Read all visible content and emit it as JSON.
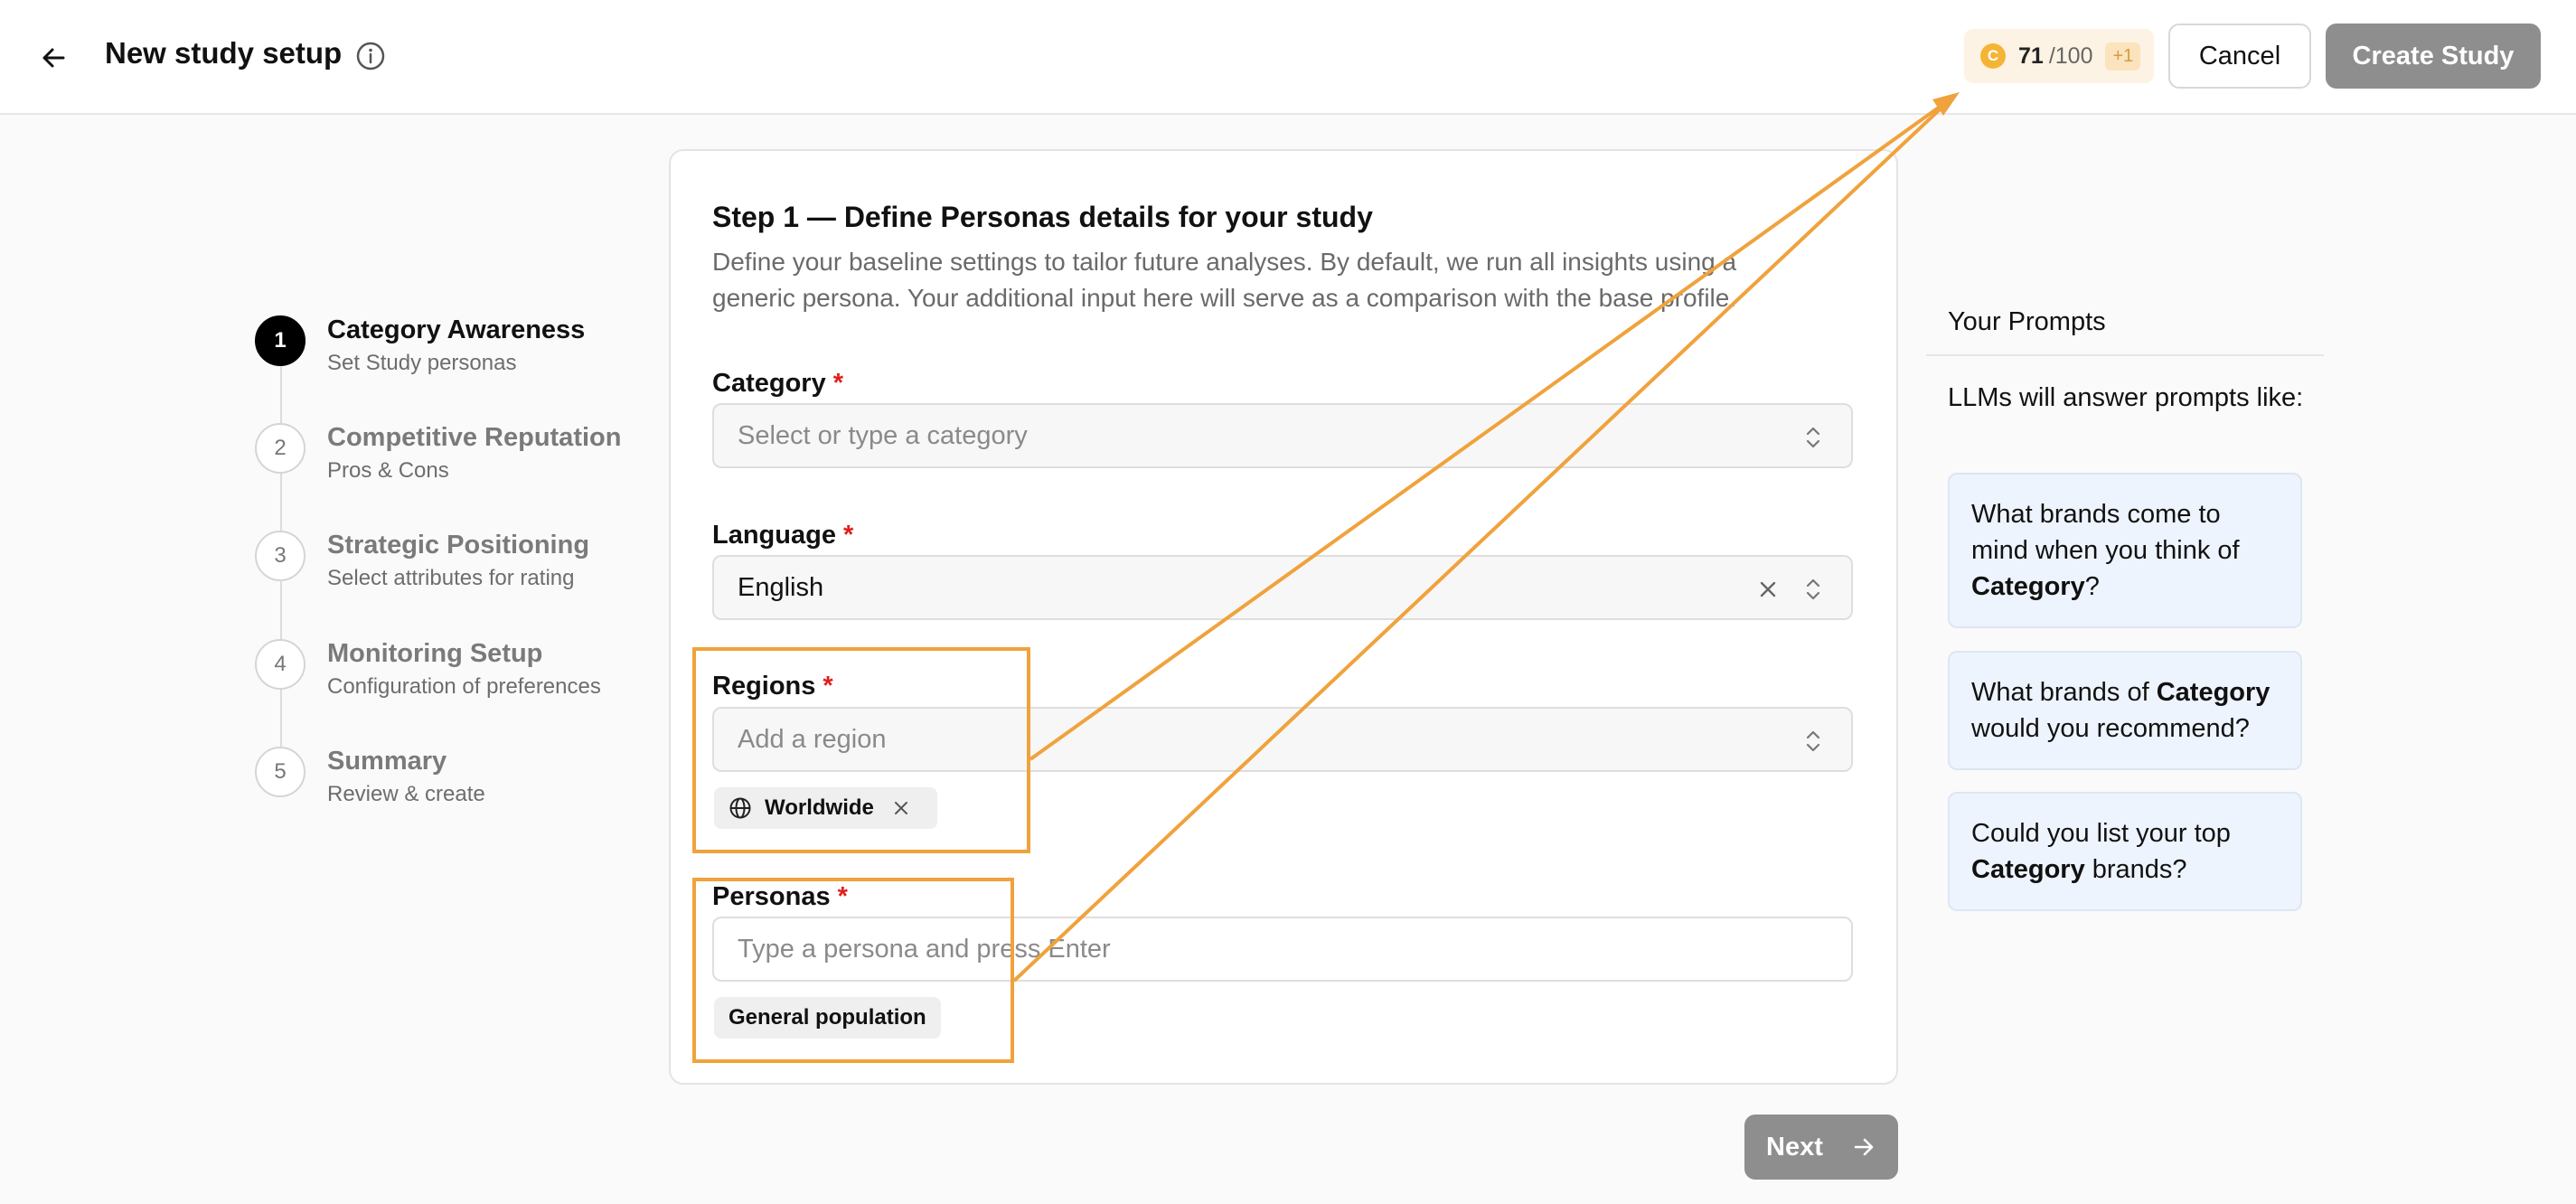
{
  "header": {
    "title": "New study setup",
    "credits": {
      "used": "71",
      "total": "/100",
      "plus": "+1",
      "coin_symbol": "C"
    },
    "cancel_label": "Cancel",
    "create_label": "Create Study"
  },
  "steps": [
    {
      "num": "1",
      "title": "Category Awareness",
      "sub": "Set Study personas"
    },
    {
      "num": "2",
      "title": "Competitive Reputation",
      "sub": "Pros & Cons"
    },
    {
      "num": "3",
      "title": "Strategic Positioning",
      "sub": "Select attributes for rating"
    },
    {
      "num": "4",
      "title": "Monitoring Setup",
      "sub": "Configuration of preferences"
    },
    {
      "num": "5",
      "title": "Summary",
      "sub": "Review & create"
    }
  ],
  "form": {
    "title": "Step 1 — Define Personas details for your study",
    "description": "Define your baseline settings to tailor future analyses. By default, we run all insights using a generic persona. Your additional input here will serve as a comparison with the base profile.",
    "required_mark": "*",
    "category": {
      "label": "Category",
      "placeholder": "Select or type a category"
    },
    "language": {
      "label": "Language",
      "value": "English"
    },
    "regions": {
      "label": "Regions",
      "placeholder": "Add a region",
      "chips": [
        "Worldwide"
      ]
    },
    "personas": {
      "label": "Personas",
      "placeholder": "Type a persona and press Enter",
      "chips": [
        "General population"
      ]
    },
    "next_label": "Next"
  },
  "prompts": {
    "title": "Your Prompts",
    "intro": "LLMs will answer prompts like:",
    "items": [
      {
        "before": "What brands come to mind when you think of ",
        "bold": "Category",
        "after": "?"
      },
      {
        "before": "What brands of ",
        "bold": "Category",
        "after": " would you recommend?"
      },
      {
        "before": "Could you list your top ",
        "bold": "Category",
        "after": " brands?"
      }
    ]
  },
  "colors": {
    "annotation": "#f0a23c",
    "required": "#e11d1d",
    "disabled_button": "#8e8e8e"
  }
}
